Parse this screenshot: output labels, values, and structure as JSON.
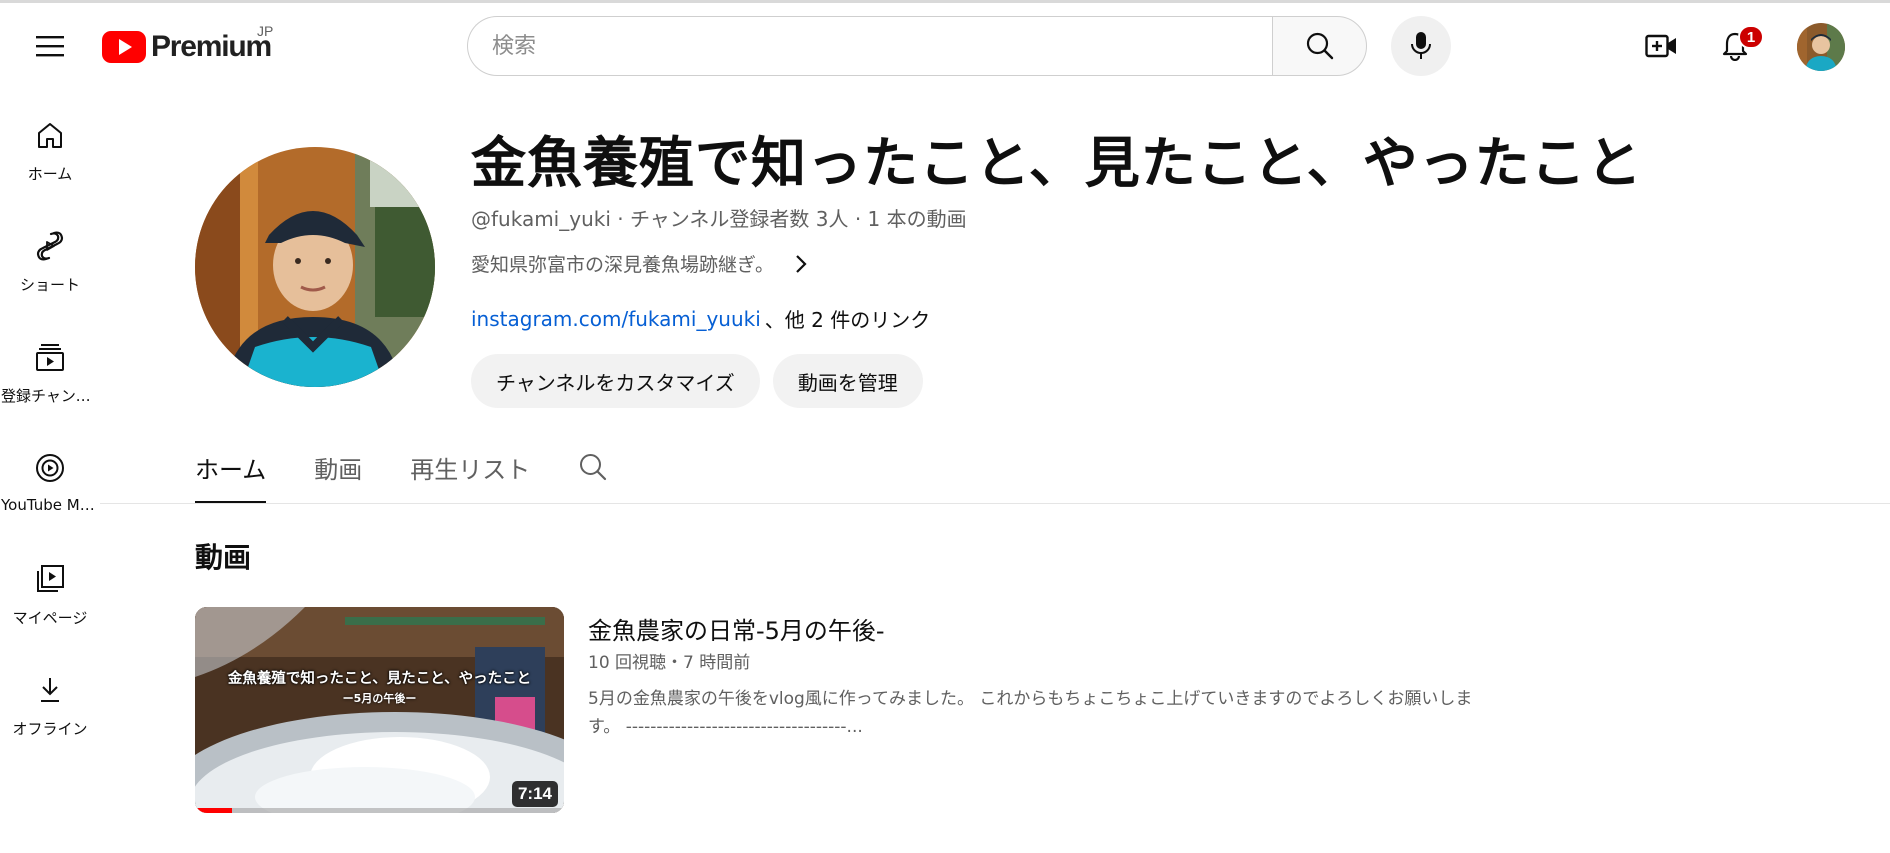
{
  "header": {
    "logo_text": "Premium",
    "country_code": "JP",
    "search_placeholder": "検索",
    "notification_count": "1"
  },
  "sidebar": {
    "items": [
      {
        "label": "ホーム",
        "icon": "home-icon"
      },
      {
        "label": "ショート",
        "icon": "shorts-icon"
      },
      {
        "label": "登録チャンネル",
        "icon": "subscriptions-icon"
      },
      {
        "label": "YouTube Music",
        "icon": "youtube-music-icon"
      },
      {
        "label": "マイページ",
        "icon": "library-icon"
      },
      {
        "label": "オフライン",
        "icon": "download-icon"
      }
    ]
  },
  "channel": {
    "title": "金魚養殖で知ったこと、見たこと、やったこと",
    "handle": "@fukami_yuki",
    "subscribers": "チャンネル登録者数 3人",
    "video_count": "1 本の動画",
    "separator": " ‧ ",
    "description": "愛知県弥富市の深見養魚場跡継ぎ。",
    "link": "instagram.com/fukami_yuuki",
    "more_links": "、他 2 件のリンク",
    "buttons": {
      "customize": "チャンネルをカスタマイズ",
      "manage": "動画を管理"
    }
  },
  "tabs": [
    {
      "label": "ホーム",
      "active": true
    },
    {
      "label": "動画",
      "active": false
    },
    {
      "label": "再生リスト",
      "active": false
    }
  ],
  "section": {
    "title": "動画"
  },
  "video": {
    "title": "金魚農家の日常-5月の午後-",
    "views": "10 回視聴",
    "age": "7 時間前",
    "meta_separator": "・",
    "description": "5月の金魚農家の午後をvlog風に作ってみました。 これからもちょこちょこ上げていきますのでよろしくお願いします。 ------------------------------------...",
    "duration": "7:14",
    "watched_fraction": 0.1,
    "thumbnail_text": "金魚養殖で知ったこと、見たこと、やったこと",
    "thumbnail_subtext": "ー5月の午後ー"
  },
  "colors": {
    "brand_red": "#ff0000",
    "link_blue": "#065fd4",
    "badge_red": "#cc0000"
  }
}
